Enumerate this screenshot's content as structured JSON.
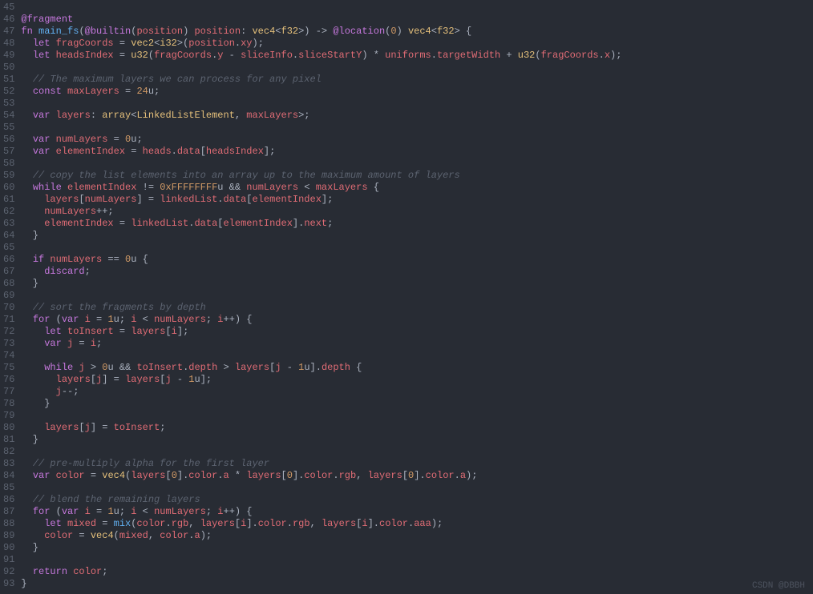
{
  "startLine": 45,
  "watermark": "CSDN @DBBH",
  "lines": [
    [
      {
        "t": "",
        "c": ""
      }
    ],
    [
      {
        "t": "@fragment",
        "c": "ann"
      }
    ],
    [
      {
        "t": "fn",
        "c": "kw"
      },
      {
        "t": " ",
        "c": ""
      },
      {
        "t": "main_fs",
        "c": "fn"
      },
      {
        "t": "(",
        "c": "punct"
      },
      {
        "t": "@builtin",
        "c": "ann"
      },
      {
        "t": "(",
        "c": "punct"
      },
      {
        "t": "position",
        "c": "var"
      },
      {
        "t": ") ",
        "c": "punct"
      },
      {
        "t": "position",
        "c": "param"
      },
      {
        "t": ": ",
        "c": "punct"
      },
      {
        "t": "vec4",
        "c": "type"
      },
      {
        "t": "<",
        "c": "punct"
      },
      {
        "t": "f32",
        "c": "type"
      },
      {
        "t": ">) -> ",
        "c": "punct"
      },
      {
        "t": "@location",
        "c": "ann"
      },
      {
        "t": "(",
        "c": "punct"
      },
      {
        "t": "0",
        "c": "num"
      },
      {
        "t": ") ",
        "c": "punct"
      },
      {
        "t": "vec4",
        "c": "type"
      },
      {
        "t": "<",
        "c": "punct"
      },
      {
        "t": "f32",
        "c": "type"
      },
      {
        "t": "> {",
        "c": "punct"
      }
    ],
    [
      {
        "t": "  ",
        "c": ""
      },
      {
        "t": "let",
        "c": "kw"
      },
      {
        "t": " ",
        "c": ""
      },
      {
        "t": "fragCoords",
        "c": "var"
      },
      {
        "t": " = ",
        "c": "punct"
      },
      {
        "t": "vec2",
        "c": "type"
      },
      {
        "t": "<",
        "c": "punct"
      },
      {
        "t": "i32",
        "c": "type"
      },
      {
        "t": ">(",
        "c": "punct"
      },
      {
        "t": "position",
        "c": "var"
      },
      {
        "t": ".",
        "c": "punct"
      },
      {
        "t": "xy",
        "c": "prop"
      },
      {
        "t": ");",
        "c": "punct"
      }
    ],
    [
      {
        "t": "  ",
        "c": ""
      },
      {
        "t": "let",
        "c": "kw"
      },
      {
        "t": " ",
        "c": ""
      },
      {
        "t": "headsIndex",
        "c": "var"
      },
      {
        "t": " = ",
        "c": "punct"
      },
      {
        "t": "u32",
        "c": "type"
      },
      {
        "t": "(",
        "c": "punct"
      },
      {
        "t": "fragCoords",
        "c": "var"
      },
      {
        "t": ".",
        "c": "punct"
      },
      {
        "t": "y",
        "c": "prop"
      },
      {
        "t": " - ",
        "c": "punct"
      },
      {
        "t": "sliceInfo",
        "c": "var"
      },
      {
        "t": ".",
        "c": "punct"
      },
      {
        "t": "sliceStartY",
        "c": "prop"
      },
      {
        "t": ") * ",
        "c": "punct"
      },
      {
        "t": "uniforms",
        "c": "var"
      },
      {
        "t": ".",
        "c": "punct"
      },
      {
        "t": "targetWidth",
        "c": "prop"
      },
      {
        "t": " + ",
        "c": "punct"
      },
      {
        "t": "u32",
        "c": "type"
      },
      {
        "t": "(",
        "c": "punct"
      },
      {
        "t": "fragCoords",
        "c": "var"
      },
      {
        "t": ".",
        "c": "punct"
      },
      {
        "t": "x",
        "c": "prop"
      },
      {
        "t": ");",
        "c": "punct"
      }
    ],
    [
      {
        "t": "",
        "c": ""
      }
    ],
    [
      {
        "t": "  ",
        "c": ""
      },
      {
        "t": "// The maximum layers we can process for any pixel",
        "c": "com"
      }
    ],
    [
      {
        "t": "  ",
        "c": ""
      },
      {
        "t": "const",
        "c": "kw"
      },
      {
        "t": " ",
        "c": ""
      },
      {
        "t": "maxLayers",
        "c": "var"
      },
      {
        "t": " = ",
        "c": "punct"
      },
      {
        "t": "24",
        "c": "num"
      },
      {
        "t": "u;",
        "c": "punct"
      }
    ],
    [
      {
        "t": "",
        "c": ""
      }
    ],
    [
      {
        "t": "  ",
        "c": ""
      },
      {
        "t": "var",
        "c": "kw"
      },
      {
        "t": " ",
        "c": ""
      },
      {
        "t": "layers",
        "c": "var"
      },
      {
        "t": ": ",
        "c": "punct"
      },
      {
        "t": "array",
        "c": "type"
      },
      {
        "t": "<",
        "c": "punct"
      },
      {
        "t": "LinkedListElement",
        "c": "type"
      },
      {
        "t": ", ",
        "c": "punct"
      },
      {
        "t": "maxLayers",
        "c": "var"
      },
      {
        "t": ">;",
        "c": "punct"
      }
    ],
    [
      {
        "t": "",
        "c": ""
      }
    ],
    [
      {
        "t": "  ",
        "c": ""
      },
      {
        "t": "var",
        "c": "kw"
      },
      {
        "t": " ",
        "c": ""
      },
      {
        "t": "numLayers",
        "c": "var"
      },
      {
        "t": " = ",
        "c": "punct"
      },
      {
        "t": "0",
        "c": "num"
      },
      {
        "t": "u;",
        "c": "punct"
      }
    ],
    [
      {
        "t": "  ",
        "c": ""
      },
      {
        "t": "var",
        "c": "kw"
      },
      {
        "t": " ",
        "c": ""
      },
      {
        "t": "elementIndex",
        "c": "var"
      },
      {
        "t": " = ",
        "c": "punct"
      },
      {
        "t": "heads",
        "c": "var"
      },
      {
        "t": ".",
        "c": "punct"
      },
      {
        "t": "data",
        "c": "prop"
      },
      {
        "t": "[",
        "c": "punct"
      },
      {
        "t": "headsIndex",
        "c": "var"
      },
      {
        "t": "];",
        "c": "punct"
      }
    ],
    [
      {
        "t": "",
        "c": ""
      }
    ],
    [
      {
        "t": "  ",
        "c": ""
      },
      {
        "t": "// copy the list elements into an array up to the maximum amount of layers",
        "c": "com"
      }
    ],
    [
      {
        "t": "  ",
        "c": ""
      },
      {
        "t": "while",
        "c": "kw"
      },
      {
        "t": " ",
        "c": ""
      },
      {
        "t": "elementIndex",
        "c": "var"
      },
      {
        "t": " != ",
        "c": "punct"
      },
      {
        "t": "0xFFFFFFFF",
        "c": "num"
      },
      {
        "t": "u && ",
        "c": "punct"
      },
      {
        "t": "numLayers",
        "c": "var"
      },
      {
        "t": " < ",
        "c": "punct"
      },
      {
        "t": "maxLayers",
        "c": "var"
      },
      {
        "t": " {",
        "c": "punct"
      }
    ],
    [
      {
        "t": "    ",
        "c": ""
      },
      {
        "t": "layers",
        "c": "var"
      },
      {
        "t": "[",
        "c": "punct"
      },
      {
        "t": "numLayers",
        "c": "var"
      },
      {
        "t": "] = ",
        "c": "punct"
      },
      {
        "t": "linkedList",
        "c": "var"
      },
      {
        "t": ".",
        "c": "punct"
      },
      {
        "t": "data",
        "c": "prop"
      },
      {
        "t": "[",
        "c": "punct"
      },
      {
        "t": "elementIndex",
        "c": "var"
      },
      {
        "t": "];",
        "c": "punct"
      }
    ],
    [
      {
        "t": "    ",
        "c": ""
      },
      {
        "t": "numLayers",
        "c": "var"
      },
      {
        "t": "++;",
        "c": "punct"
      }
    ],
    [
      {
        "t": "    ",
        "c": ""
      },
      {
        "t": "elementIndex",
        "c": "var"
      },
      {
        "t": " = ",
        "c": "punct"
      },
      {
        "t": "linkedList",
        "c": "var"
      },
      {
        "t": ".",
        "c": "punct"
      },
      {
        "t": "data",
        "c": "prop"
      },
      {
        "t": "[",
        "c": "punct"
      },
      {
        "t": "elementIndex",
        "c": "var"
      },
      {
        "t": "].",
        "c": "punct"
      },
      {
        "t": "next",
        "c": "prop"
      },
      {
        "t": ";",
        "c": "punct"
      }
    ],
    [
      {
        "t": "  }",
        "c": "punct"
      }
    ],
    [
      {
        "t": "",
        "c": ""
      }
    ],
    [
      {
        "t": "  ",
        "c": ""
      },
      {
        "t": "if",
        "c": "kw"
      },
      {
        "t": " ",
        "c": ""
      },
      {
        "t": "numLayers",
        "c": "var"
      },
      {
        "t": " == ",
        "c": "punct"
      },
      {
        "t": "0",
        "c": "num"
      },
      {
        "t": "u {",
        "c": "punct"
      }
    ],
    [
      {
        "t": "    ",
        "c": ""
      },
      {
        "t": "discard",
        "c": "kw"
      },
      {
        "t": ";",
        "c": "punct"
      }
    ],
    [
      {
        "t": "  }",
        "c": "punct"
      }
    ],
    [
      {
        "t": "",
        "c": ""
      }
    ],
    [
      {
        "t": "  ",
        "c": ""
      },
      {
        "t": "// sort the fragments by depth",
        "c": "com"
      }
    ],
    [
      {
        "t": "  ",
        "c": ""
      },
      {
        "t": "for",
        "c": "kw"
      },
      {
        "t": " (",
        "c": "punct"
      },
      {
        "t": "var",
        "c": "kw"
      },
      {
        "t": " ",
        "c": ""
      },
      {
        "t": "i",
        "c": "var"
      },
      {
        "t": " = ",
        "c": "punct"
      },
      {
        "t": "1",
        "c": "num"
      },
      {
        "t": "u; ",
        "c": "punct"
      },
      {
        "t": "i",
        "c": "var"
      },
      {
        "t": " < ",
        "c": "punct"
      },
      {
        "t": "numLayers",
        "c": "var"
      },
      {
        "t": "; ",
        "c": "punct"
      },
      {
        "t": "i",
        "c": "var"
      },
      {
        "t": "++) {",
        "c": "punct"
      }
    ],
    [
      {
        "t": "    ",
        "c": ""
      },
      {
        "t": "let",
        "c": "kw"
      },
      {
        "t": " ",
        "c": ""
      },
      {
        "t": "toInsert",
        "c": "var"
      },
      {
        "t": " = ",
        "c": "punct"
      },
      {
        "t": "layers",
        "c": "var"
      },
      {
        "t": "[",
        "c": "punct"
      },
      {
        "t": "i",
        "c": "var"
      },
      {
        "t": "];",
        "c": "punct"
      }
    ],
    [
      {
        "t": "    ",
        "c": ""
      },
      {
        "t": "var",
        "c": "kw"
      },
      {
        "t": " ",
        "c": ""
      },
      {
        "t": "j",
        "c": "var"
      },
      {
        "t": " = ",
        "c": "punct"
      },
      {
        "t": "i",
        "c": "var"
      },
      {
        "t": ";",
        "c": "punct"
      }
    ],
    [
      {
        "t": "",
        "c": ""
      }
    ],
    [
      {
        "t": "    ",
        "c": ""
      },
      {
        "t": "while",
        "c": "kw"
      },
      {
        "t": " ",
        "c": ""
      },
      {
        "t": "j",
        "c": "var"
      },
      {
        "t": " > ",
        "c": "punct"
      },
      {
        "t": "0",
        "c": "num"
      },
      {
        "t": "u && ",
        "c": "punct"
      },
      {
        "t": "toInsert",
        "c": "var"
      },
      {
        "t": ".",
        "c": "punct"
      },
      {
        "t": "depth",
        "c": "prop"
      },
      {
        "t": " > ",
        "c": "punct"
      },
      {
        "t": "layers",
        "c": "var"
      },
      {
        "t": "[",
        "c": "punct"
      },
      {
        "t": "j",
        "c": "var"
      },
      {
        "t": " - ",
        "c": "punct"
      },
      {
        "t": "1",
        "c": "num"
      },
      {
        "t": "u].",
        "c": "punct"
      },
      {
        "t": "depth",
        "c": "prop"
      },
      {
        "t": " {",
        "c": "punct"
      }
    ],
    [
      {
        "t": "      ",
        "c": ""
      },
      {
        "t": "layers",
        "c": "var"
      },
      {
        "t": "[",
        "c": "punct"
      },
      {
        "t": "j",
        "c": "var"
      },
      {
        "t": "] = ",
        "c": "punct"
      },
      {
        "t": "layers",
        "c": "var"
      },
      {
        "t": "[",
        "c": "punct"
      },
      {
        "t": "j",
        "c": "var"
      },
      {
        "t": " - ",
        "c": "punct"
      },
      {
        "t": "1",
        "c": "num"
      },
      {
        "t": "u];",
        "c": "punct"
      }
    ],
    [
      {
        "t": "      ",
        "c": ""
      },
      {
        "t": "j",
        "c": "var"
      },
      {
        "t": "--;",
        "c": "punct"
      }
    ],
    [
      {
        "t": "    }",
        "c": "punct"
      }
    ],
    [
      {
        "t": "",
        "c": ""
      }
    ],
    [
      {
        "t": "    ",
        "c": ""
      },
      {
        "t": "layers",
        "c": "var"
      },
      {
        "t": "[",
        "c": "punct"
      },
      {
        "t": "j",
        "c": "var"
      },
      {
        "t": "] = ",
        "c": "punct"
      },
      {
        "t": "toInsert",
        "c": "var"
      },
      {
        "t": ";",
        "c": "punct"
      }
    ],
    [
      {
        "t": "  }",
        "c": "punct"
      }
    ],
    [
      {
        "t": "",
        "c": ""
      }
    ],
    [
      {
        "t": "  ",
        "c": ""
      },
      {
        "t": "// pre-multiply alpha for the first layer",
        "c": "com"
      }
    ],
    [
      {
        "t": "  ",
        "c": ""
      },
      {
        "t": "var",
        "c": "kw"
      },
      {
        "t": " ",
        "c": ""
      },
      {
        "t": "color",
        "c": "var"
      },
      {
        "t": " = ",
        "c": "punct"
      },
      {
        "t": "vec4",
        "c": "type"
      },
      {
        "t": "(",
        "c": "punct"
      },
      {
        "t": "layers",
        "c": "var"
      },
      {
        "t": "[",
        "c": "punct"
      },
      {
        "t": "0",
        "c": "num"
      },
      {
        "t": "].",
        "c": "punct"
      },
      {
        "t": "color",
        "c": "prop"
      },
      {
        "t": ".",
        "c": "punct"
      },
      {
        "t": "a",
        "c": "prop"
      },
      {
        "t": " * ",
        "c": "punct"
      },
      {
        "t": "layers",
        "c": "var"
      },
      {
        "t": "[",
        "c": "punct"
      },
      {
        "t": "0",
        "c": "num"
      },
      {
        "t": "].",
        "c": "punct"
      },
      {
        "t": "color",
        "c": "prop"
      },
      {
        "t": ".",
        "c": "punct"
      },
      {
        "t": "rgb",
        "c": "prop"
      },
      {
        "t": ", ",
        "c": "punct"
      },
      {
        "t": "layers",
        "c": "var"
      },
      {
        "t": "[",
        "c": "punct"
      },
      {
        "t": "0",
        "c": "num"
      },
      {
        "t": "].",
        "c": "punct"
      },
      {
        "t": "color",
        "c": "prop"
      },
      {
        "t": ".",
        "c": "punct"
      },
      {
        "t": "a",
        "c": "prop"
      },
      {
        "t": ");",
        "c": "punct"
      }
    ],
    [
      {
        "t": "",
        "c": ""
      }
    ],
    [
      {
        "t": "  ",
        "c": ""
      },
      {
        "t": "// blend the remaining layers",
        "c": "com"
      }
    ],
    [
      {
        "t": "  ",
        "c": ""
      },
      {
        "t": "for",
        "c": "kw"
      },
      {
        "t": " (",
        "c": "punct"
      },
      {
        "t": "var",
        "c": "kw"
      },
      {
        "t": " ",
        "c": ""
      },
      {
        "t": "i",
        "c": "var"
      },
      {
        "t": " = ",
        "c": "punct"
      },
      {
        "t": "1",
        "c": "num"
      },
      {
        "t": "u; ",
        "c": "punct"
      },
      {
        "t": "i",
        "c": "var"
      },
      {
        "t": " < ",
        "c": "punct"
      },
      {
        "t": "numLayers",
        "c": "var"
      },
      {
        "t": "; ",
        "c": "punct"
      },
      {
        "t": "i",
        "c": "var"
      },
      {
        "t": "++) {",
        "c": "punct"
      }
    ],
    [
      {
        "t": "    ",
        "c": ""
      },
      {
        "t": "let",
        "c": "kw"
      },
      {
        "t": " ",
        "c": ""
      },
      {
        "t": "mixed",
        "c": "var"
      },
      {
        "t": " = ",
        "c": "punct"
      },
      {
        "t": "mix",
        "c": "fn"
      },
      {
        "t": "(",
        "c": "punct"
      },
      {
        "t": "color",
        "c": "var"
      },
      {
        "t": ".",
        "c": "punct"
      },
      {
        "t": "rgb",
        "c": "prop"
      },
      {
        "t": ", ",
        "c": "punct"
      },
      {
        "t": "layers",
        "c": "var"
      },
      {
        "t": "[",
        "c": "punct"
      },
      {
        "t": "i",
        "c": "var"
      },
      {
        "t": "].",
        "c": "punct"
      },
      {
        "t": "color",
        "c": "prop"
      },
      {
        "t": ".",
        "c": "punct"
      },
      {
        "t": "rgb",
        "c": "prop"
      },
      {
        "t": ", ",
        "c": "punct"
      },
      {
        "t": "layers",
        "c": "var"
      },
      {
        "t": "[",
        "c": "punct"
      },
      {
        "t": "i",
        "c": "var"
      },
      {
        "t": "].",
        "c": "punct"
      },
      {
        "t": "color",
        "c": "prop"
      },
      {
        "t": ".",
        "c": "punct"
      },
      {
        "t": "aaa",
        "c": "prop"
      },
      {
        "t": ");",
        "c": "punct"
      }
    ],
    [
      {
        "t": "    ",
        "c": ""
      },
      {
        "t": "color",
        "c": "var"
      },
      {
        "t": " = ",
        "c": "punct"
      },
      {
        "t": "vec4",
        "c": "type"
      },
      {
        "t": "(",
        "c": "punct"
      },
      {
        "t": "mixed",
        "c": "var"
      },
      {
        "t": ", ",
        "c": "punct"
      },
      {
        "t": "color",
        "c": "var"
      },
      {
        "t": ".",
        "c": "punct"
      },
      {
        "t": "a",
        "c": "prop"
      },
      {
        "t": ");",
        "c": "punct"
      }
    ],
    [
      {
        "t": "  }",
        "c": "punct"
      }
    ],
    [
      {
        "t": "",
        "c": ""
      }
    ],
    [
      {
        "t": "  ",
        "c": ""
      },
      {
        "t": "return",
        "c": "kw"
      },
      {
        "t": " ",
        "c": ""
      },
      {
        "t": "color",
        "c": "var"
      },
      {
        "t": ";",
        "c": "punct"
      }
    ],
    [
      {
        "t": "}",
        "c": "punct"
      }
    ]
  ]
}
